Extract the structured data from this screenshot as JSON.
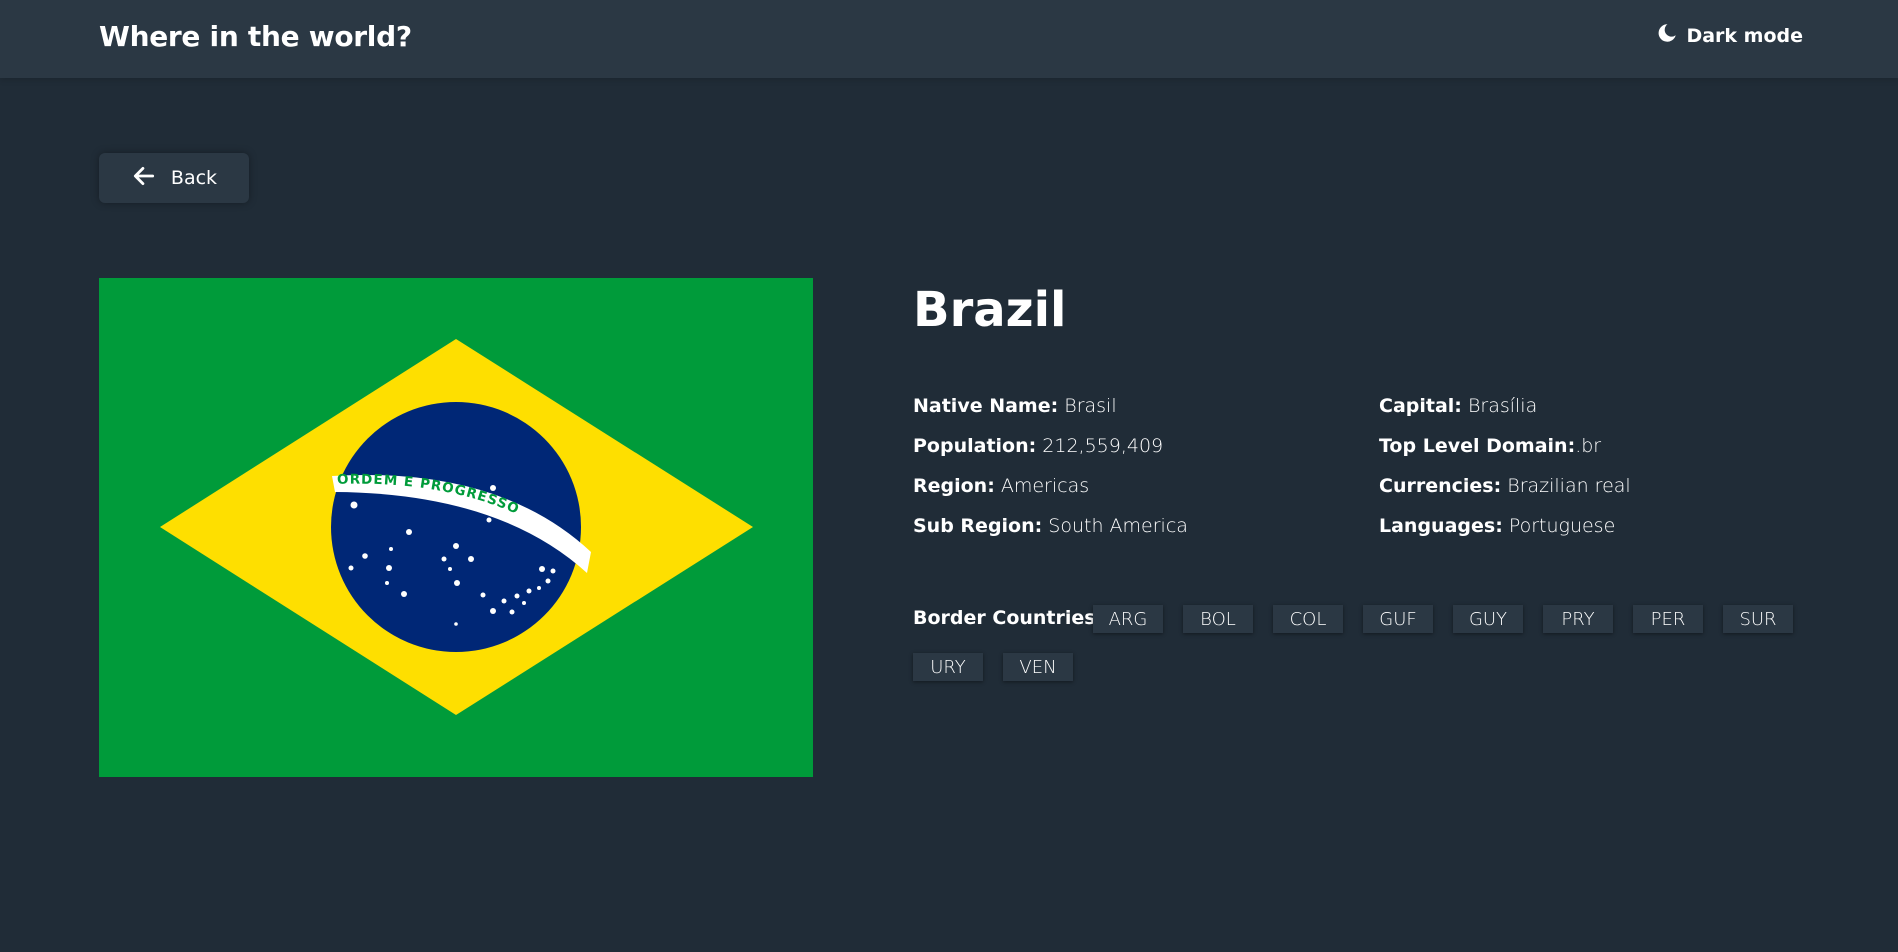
{
  "header": {
    "title": "Where in the world?",
    "mode_label": "Dark mode",
    "mode_icon": "moon-icon"
  },
  "back_button": {
    "label": "Back",
    "icon": "arrow-left-icon"
  },
  "flag": {
    "banner_text": "ORDEM E PROGRESSO",
    "colors": {
      "green": "#009b3a",
      "yellow": "#fedf00",
      "blue": "#002776",
      "white": "#ffffff"
    }
  },
  "country": {
    "name": "Brazil",
    "details_left": [
      {
        "label": "Native Name:",
        "value": "Brasil"
      },
      {
        "label": "Population:",
        "value": "212,559,409"
      },
      {
        "label": "Region:",
        "value": "Americas"
      },
      {
        "label": "Sub Region:",
        "value": "South America"
      }
    ],
    "details_right": [
      {
        "label": "Capital:",
        "value": "Brasília"
      },
      {
        "label": "Top Level Domain:",
        "value": ".br"
      },
      {
        "label": "Currencies:",
        "value": "Brazilian real"
      },
      {
        "label": "Languages:",
        "value": "Portuguese"
      }
    ],
    "border_label": "Border Countries:",
    "borders": [
      "ARG",
      "BOL",
      "COL",
      "GUF",
      "GUY",
      "PRY",
      "PER",
      "SUR",
      "URY",
      "VEN"
    ]
  },
  "theme": {
    "background": "#202c37",
    "element": "#2b3844",
    "text": "#ffffff"
  }
}
